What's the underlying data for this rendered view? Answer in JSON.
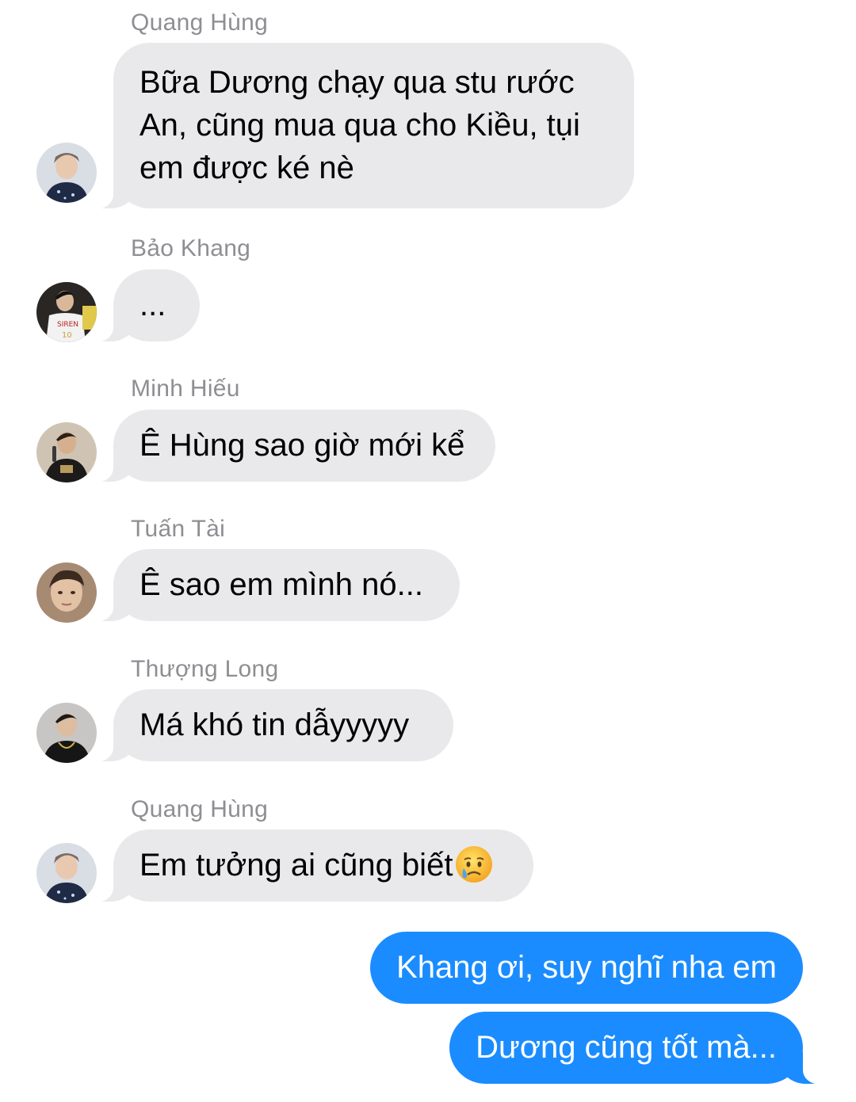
{
  "thread": {
    "incoming": [
      {
        "sender": "Quang Hùng",
        "avatar": "avatar-quang-hung",
        "lines": [
          "Bữa Dương chạy qua stu rước",
          "An, cũng mua qua cho Kiều, tụi",
          "em được ké nè"
        ]
      },
      {
        "sender": "Bảo Khang",
        "avatar": "avatar-bao-khang",
        "text": "..."
      },
      {
        "sender": "Minh Hiếu",
        "avatar": "avatar-minh-hieu",
        "text": "Ê Hùng sao giờ mới kể"
      },
      {
        "sender": "Tuấn Tài",
        "avatar": "avatar-tuan-tai",
        "text": "Ê sao em mình nó..."
      },
      {
        "sender": "Thượng Long",
        "avatar": "avatar-thuong-long",
        "text": "Má khó tin dẫyyyyy"
      },
      {
        "sender": "Quang Hùng",
        "avatar": "avatar-quang-hung",
        "text": "Em tưởng ai cũng biết",
        "emoji": "crying-face-emoji"
      }
    ],
    "outgoing": [
      {
        "text": "Khang ơi, suy nghĩ nha em"
      },
      {
        "text": "Dương cũng tốt mà..."
      }
    ]
  },
  "colors": {
    "incoming_bubble": "#e9e9eb",
    "outgoing_bubble": "#1a8cff",
    "sender_name": "#8e8e93"
  }
}
